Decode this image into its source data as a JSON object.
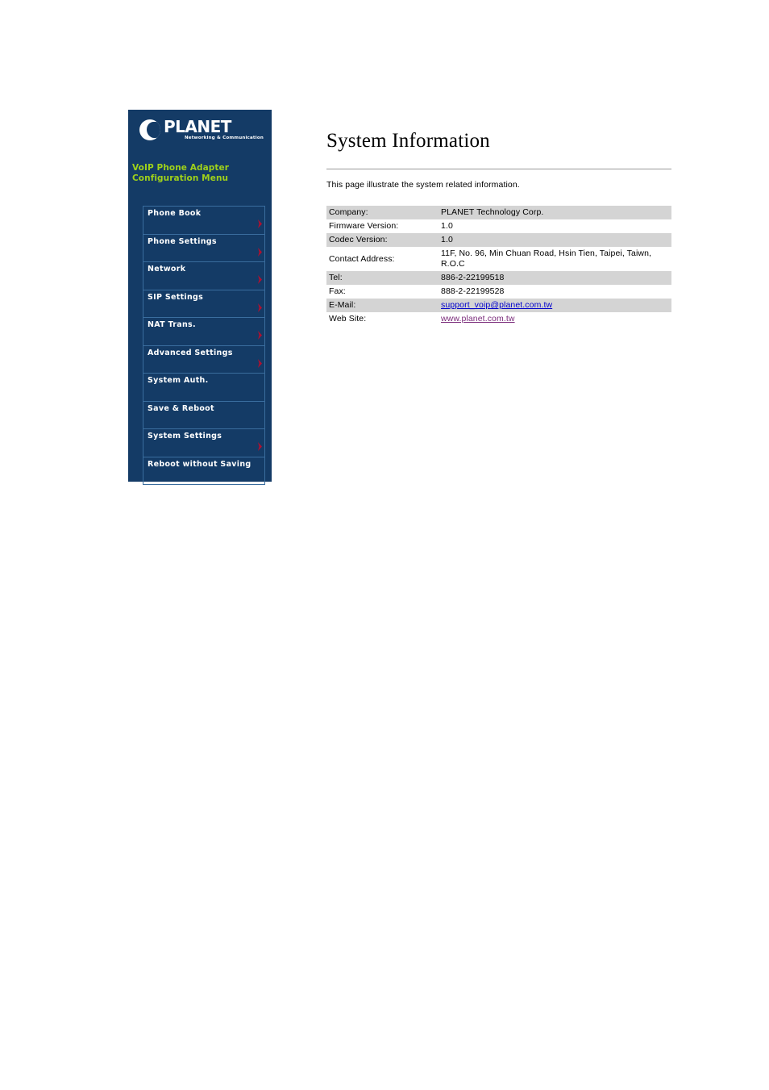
{
  "sidebar": {
    "logo": {
      "wordmark": "PLANET",
      "tagline": "Networking & Communication",
      "mark_icon": "planet-globe-icon"
    },
    "subtitle_line1": "VoIP Phone Adapter",
    "subtitle_line2": "Configuration Menu",
    "accent_color": "#9fd11a",
    "background_color": "#143b66",
    "chevron_color": "#b01030",
    "items": [
      {
        "label": "Phone Book",
        "chevron": true
      },
      {
        "label": "Phone Settings",
        "chevron": true
      },
      {
        "label": "Network",
        "chevron": true
      },
      {
        "label": "SIP Settings",
        "chevron": true
      },
      {
        "label": "NAT Trans.",
        "chevron": true
      },
      {
        "label": "Advanced Settings",
        "chevron": true
      },
      {
        "label": "System Auth.",
        "chevron": false
      },
      {
        "label": "Save & Reboot",
        "chevron": false
      },
      {
        "label": "System Settings",
        "chevron": true
      },
      {
        "label": "Reboot without Saving",
        "chevron": false
      }
    ]
  },
  "main": {
    "title": "System Information",
    "description": "This page illustrate the system related information.",
    "table": {
      "rows": [
        {
          "key": "Company:",
          "value": "PLANET Technology Corp.",
          "shaded": true,
          "type": "text"
        },
        {
          "key": "Firmware Version:",
          "value": "1.0",
          "shaded": false,
          "type": "text"
        },
        {
          "key": "Codec Version:",
          "value": "1.0",
          "shaded": true,
          "type": "text"
        },
        {
          "key": "Contact Address:",
          "value": "11F, No. 96, Min Chuan Road, Hsin Tien, Taipei, Taiwn, R.O.C",
          "shaded": false,
          "type": "text"
        },
        {
          "key": "Tel:",
          "value": "886-2-22199518",
          "shaded": true,
          "type": "text"
        },
        {
          "key": "Fax:",
          "value": "888-2-22199528",
          "shaded": false,
          "type": "text"
        },
        {
          "key": "E-Mail:",
          "value": "support_voip@planet.com.tw",
          "shaded": true,
          "type": "link-mail"
        },
        {
          "key": "Web Site:",
          "value": "www.planet.com.tw",
          "shaded": false,
          "type": "link-web"
        }
      ]
    }
  }
}
